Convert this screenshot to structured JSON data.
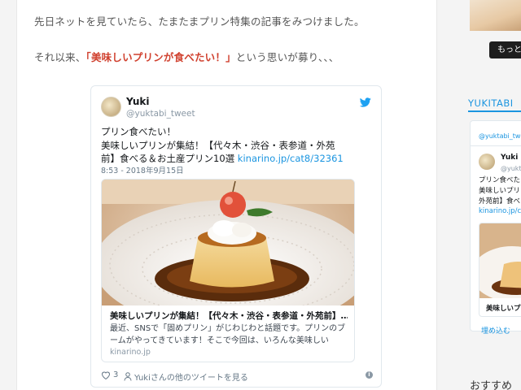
{
  "article": {
    "para1": "先日ネットを見ていたら、たまたまプリン特集の記事をみつけました。",
    "para2_before": "それ以来、",
    "para2_highlight": "「美味しいプリンが食べたい！」",
    "para2_after": "という思いが募り、、、"
  },
  "tweet": {
    "name": "Yuki",
    "handle": "@yuktabi_tweet",
    "text_line1": "プリン食べたい！",
    "text_line2": "美味しいプリンが集結！【代々木・渋谷・表参道・外苑",
    "text_line3": "前】食べる＆お土産プリン10選 ",
    "link": "kinarino.jp/cat8/32361",
    "date": "8:53 - 2018年9月15日",
    "card_title": "美味しいプリンが集結！【代々木・渋谷・表参道・外苑前】…",
    "card_desc": "最近、SNSで「固めプリン」がじわじわと話題です。プリンのブームがやってきています！そこで今回は、いろんな美味しい",
    "card_domain": "kinarino.jp",
    "likes": "3",
    "more_label": "Yukiさんの他のツイートを見る"
  },
  "sidebar": {
    "button": "もっと",
    "title": "YUKITABI",
    "widget_handle": "@yuktabi_twee",
    "widget_name": "Yuki",
    "widget_uhandle": "@yukta",
    "widget_text": "プリン食べたい\n美味しいプリン\n外苑前】食べる",
    "widget_link": "kinarino.jp/ca",
    "widget_card_title": "美味しいプリ",
    "embed": "埋め込む",
    "recommend": "おすすめ"
  },
  "colors": {
    "accent": "#1b95e0",
    "highlight": "#d0402e"
  }
}
